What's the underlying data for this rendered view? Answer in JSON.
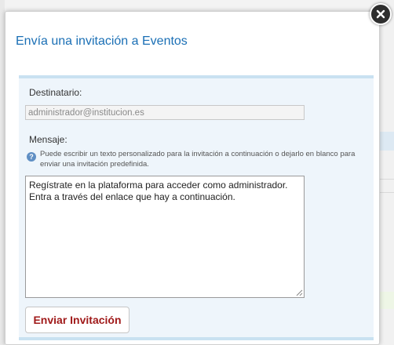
{
  "modal": {
    "title": "Envía una invitación a Eventos",
    "close_icon": "close-icon"
  },
  "form": {
    "recipient_label": "Destinatario:",
    "recipient_value": "administrador@institucion.es",
    "message_label": "Mensaje:",
    "help_icon": "question-icon",
    "help_text": "Puede escribir un texto personalizado para la invitación a continuación o dejarlo en blanco para enviar una invitación predefinida.",
    "message_value": "Regístrate en la plataforma para acceder como administrador.\nEntra a través del enlace que hay a continuación.",
    "submit_label": "Enviar Invitación"
  },
  "colors": {
    "title": "#1a6fb5",
    "panel_bg": "#eef5fb",
    "panel_border": "#c9e1f1",
    "submit_text": "#a01a1a"
  }
}
